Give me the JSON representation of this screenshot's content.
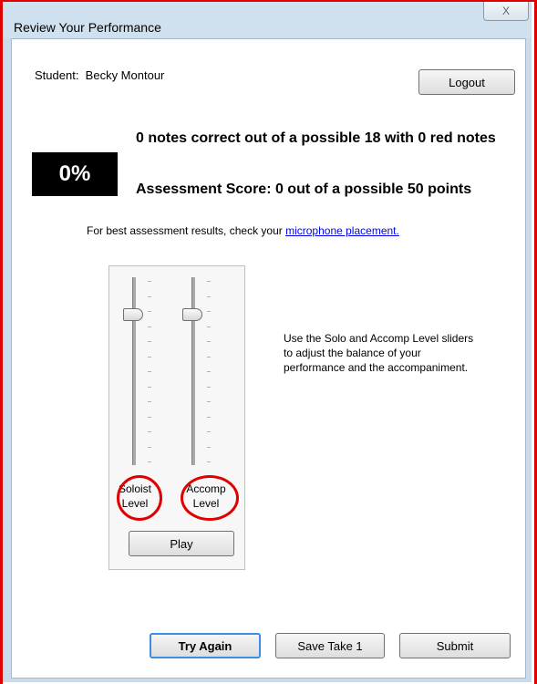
{
  "window": {
    "title": "Review Your Performance",
    "close_label": "X"
  },
  "student": {
    "label": "Student:",
    "name": "Becky Montour"
  },
  "logout_label": "Logout",
  "score": {
    "percent": "0%",
    "notes_text": "0 notes correct out of a possible 18 with 0 red notes",
    "assessment_text": "Assessment Score: 0 out of a possible 50 points"
  },
  "hint": {
    "text": "For best assessment results, check your ",
    "link": "microphone placement."
  },
  "mixer": {
    "soloist_label_line1": "Soloist",
    "soloist_label_line2": "Level",
    "accomp_label_line1": "Accomp",
    "accomp_label_line2": "Level",
    "play_label": "Play",
    "soloist_level": 0.8,
    "accomp_level": 0.8
  },
  "instructions": "Use the Solo and Accomp Level sliders to adjust the balance of your performance and the accompaniment.",
  "buttons": {
    "try_again": "Try Again",
    "save_take": "Save Take 1",
    "submit": "Submit"
  },
  "colors": {
    "highlight_red": "#e00000",
    "link_blue": "#0000ee",
    "window_frame": "#c9dceb"
  }
}
